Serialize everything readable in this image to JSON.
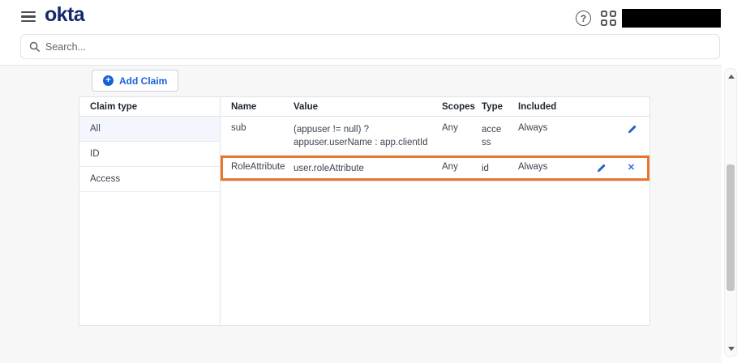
{
  "topbar": {
    "logo_text": "okta"
  },
  "search": {
    "placeholder": "Search..."
  },
  "content": {
    "add_claim_button": "Add Claim",
    "claim_types": {
      "header": "Claim type",
      "items": [
        {
          "label": "All",
          "selected": true
        },
        {
          "label": "ID",
          "selected": false
        },
        {
          "label": "Access",
          "selected": false
        }
      ]
    },
    "claims_table": {
      "columns": [
        "Name",
        "Value",
        "Scopes",
        "Type",
        "Included"
      ],
      "rows": [
        {
          "name": "sub",
          "value": "(appuser != null) ? appuser.userName : app.clientId",
          "scopes": "Any",
          "type": "access",
          "included": "Always",
          "actions": [
            "edit"
          ],
          "highlighted": false
        },
        {
          "name": "RoleAttribute",
          "value": "user.roleAttribute",
          "scopes": "Any",
          "type": "id",
          "included": "Always",
          "actions": [
            "edit",
            "delete"
          ],
          "highlighted": true
        }
      ]
    }
  },
  "icons": {
    "add_glyph": "+",
    "help_glyph": "?",
    "close_glyph": "✕"
  },
  "colors": {
    "accent_blue": "#1662dd",
    "highlight_orange": "#e8772c",
    "selected_bg": "#f3f6fc",
    "logo_navy": "#14286b"
  }
}
